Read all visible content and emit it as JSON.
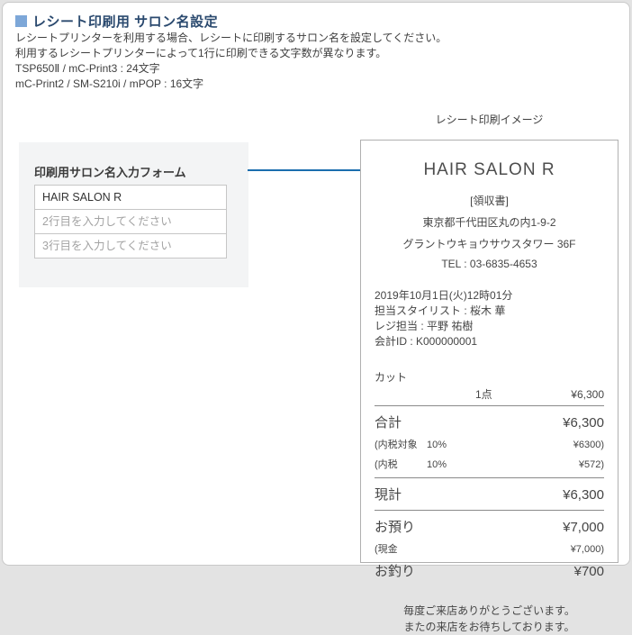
{
  "colors": {
    "accent_blue": "#1b6eae",
    "header_square_blue": "#7da7d8",
    "heading_text": "#2b4a6f",
    "panel_border": "#c9c9c9",
    "receipt_border": "#b0b0b0"
  },
  "page": {
    "header": {
      "title": "レシート印刷用 サロン名設定"
    },
    "description": [
      "レシートプリンターを利用する場合、レシートに印刷するサロン名を設定してください。",
      "利用するレシートプリンターによって1行に印刷できる文字数が異なります。",
      "TSP650Ⅱ / mC-Print3 : 24文字",
      "mC-Print2 / SM-S210i / mPOP : 16文字"
    ]
  },
  "form": {
    "title": "印刷用サロン名入力フォーム",
    "inputs": [
      {
        "value": "HAIR SALON R",
        "placeholder": ""
      },
      {
        "value": "",
        "placeholder": "2行目を入力してください"
      },
      {
        "value": "",
        "placeholder": "3行目を入力してください"
      }
    ]
  },
  "preview": {
    "label": "レシート印刷イメージ",
    "receipt": {
      "salon_name": "HAIR SALON R",
      "doc_type": "[領収書]",
      "address_lines": [
        "東京都千代田区丸の内1-9-2",
        "グラントウキョウサウスタワー 36F"
      ],
      "tel": "TEL : 03-6835-4653",
      "info_lines": [
        "2019年10月1日(火)12時01分",
        "担当スタイリスト : 桜木 華",
        "レジ担当 : 平野 祐樹",
        "会計ID : K000000001"
      ],
      "item": {
        "name": "カット",
        "qty": "1点",
        "price": "¥6,300"
      },
      "totals": {
        "subtotal": {
          "label": "合計",
          "value": "¥6,300"
        },
        "tax_target": {
          "label": "(内税対象",
          "pct": "10%",
          "value": "¥6300)"
        },
        "tax": {
          "label": "(内税",
          "pct": "10%",
          "value": "¥572)"
        },
        "net_total": {
          "label": "現計",
          "value": "¥6,300"
        },
        "deposit": {
          "label": "お預り",
          "value": "¥7,000"
        },
        "cash": {
          "label": "(現金",
          "value": "¥7,000)"
        },
        "change": {
          "label": "お釣り",
          "value": "¥700"
        }
      },
      "footer": [
        "毎度ご来店ありがとうございます。",
        "またの来店をお待ちしております。"
      ]
    }
  }
}
